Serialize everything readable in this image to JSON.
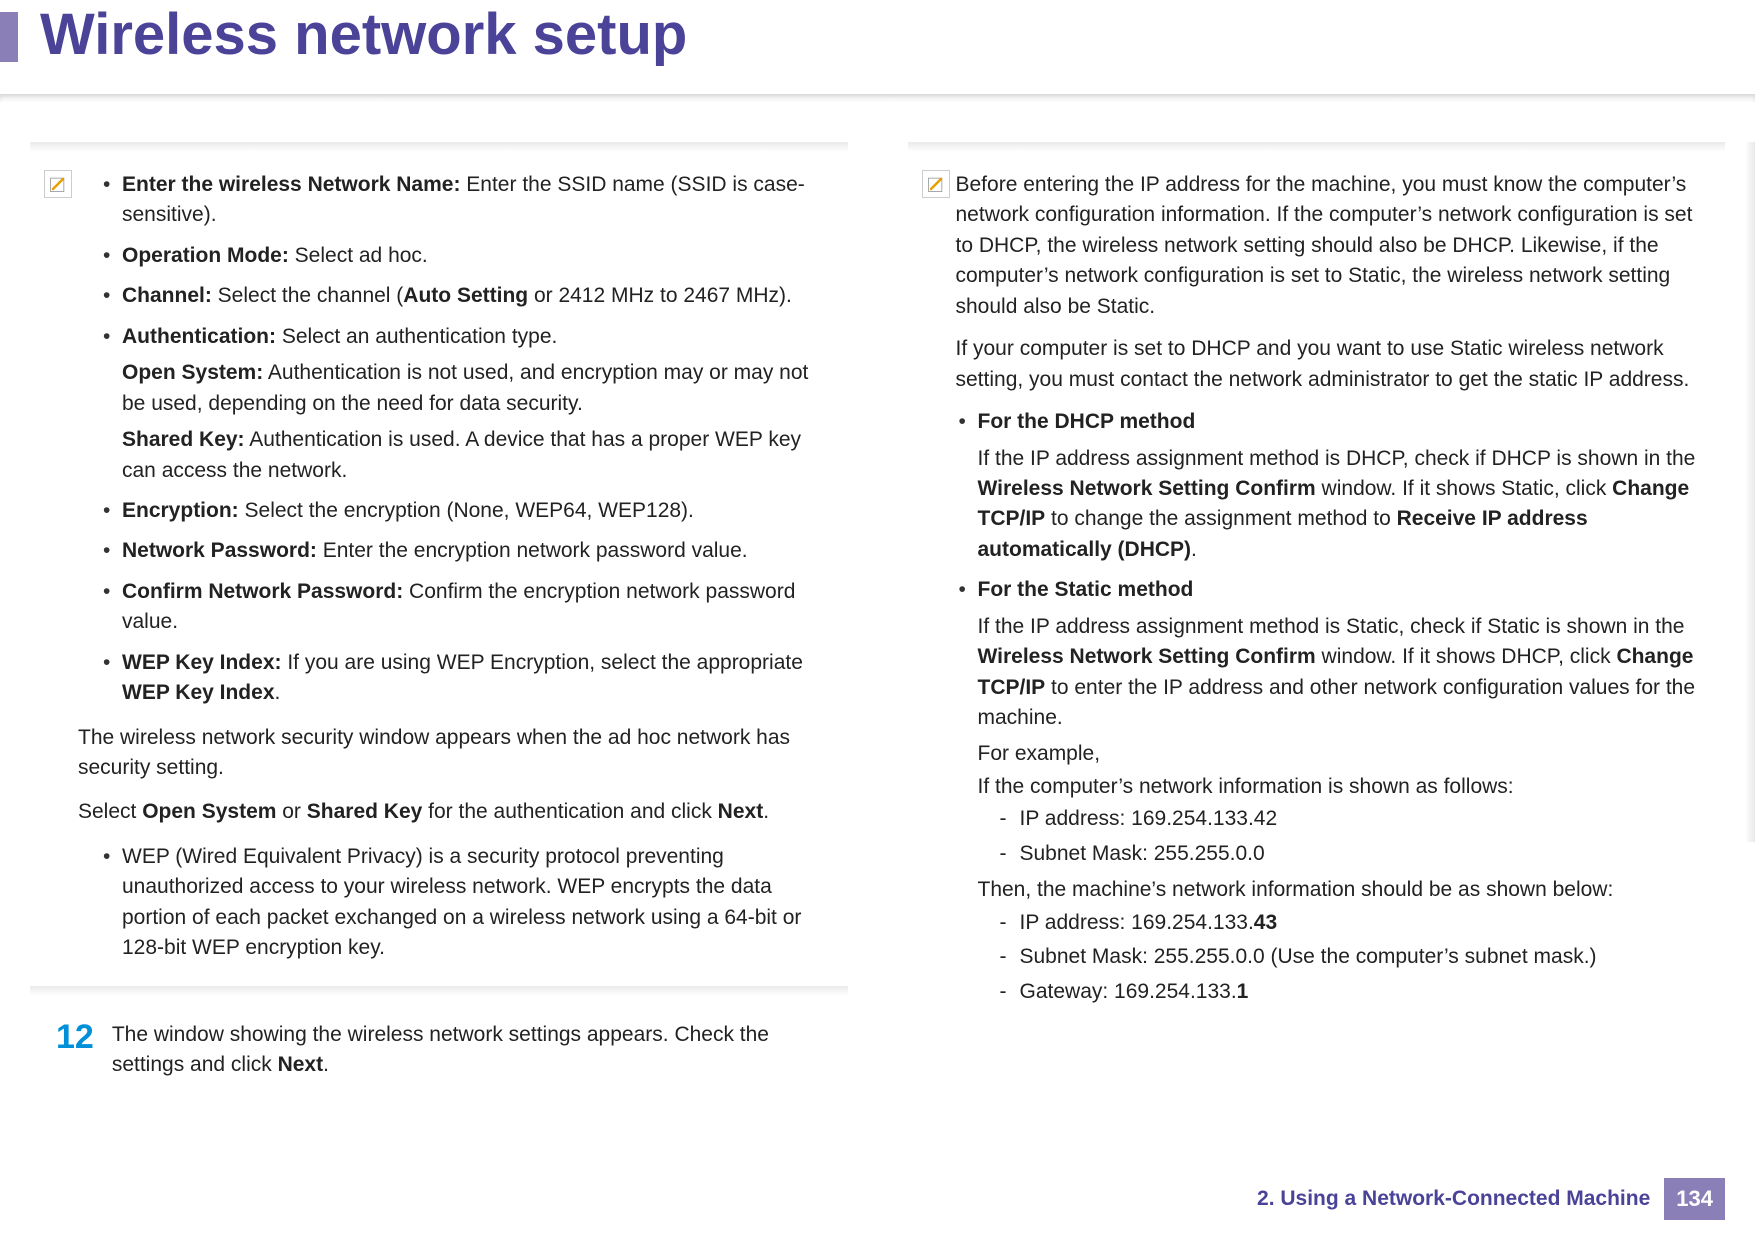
{
  "header": {
    "title": "Wireless network setup"
  },
  "left": {
    "items": [
      {
        "label": "Enter the wireless Network Name:",
        "text": " Enter the SSID name (SSID is case-sensitive)."
      },
      {
        "label": "Operation Mode:",
        "text": " Select ad hoc."
      },
      {
        "label": "Channel:",
        "pre": " Select the channel (",
        "bold2": "Auto Setting",
        "post": " or 2412 MHz to 2467 MHz)."
      },
      {
        "label": "Authentication:",
        "text": " Select an authentication type."
      },
      {
        "label": "Encryption:",
        "text": " Select the encryption (None, WEP64, WEP128)."
      },
      {
        "label": "Network Password:",
        "text": " Enter the encryption network password value."
      },
      {
        "label": "Confirm Network Password:",
        "text": " Confirm the encryption network password value."
      },
      {
        "wep_label": "WEP Key Index:",
        "wep_pre": " If you are using WEP Encryption, select the appropriate ",
        "wep_bold": "WEP Key Index",
        "wep_post": "."
      }
    ],
    "auth_sub": {
      "open_label": "Open System:",
      "open_text": " Authentication is not used, and encryption may or may not be used, depending on the need for data security.",
      "shared_label": "Shared Key:",
      "shared_text": " Authentication is used. A device that has a proper WEP key can access the network."
    },
    "p1": "The wireless network security window appears when the ad hoc network has security setting.",
    "p2_pre": "Select ",
    "p2_b1": "Open System",
    "p2_mid": " or ",
    "p2_b2": "Shared Key",
    "p2_mid2": " for the authentication and click ",
    "p2_b3": "Next",
    "p2_post": ".",
    "wep_desc": "WEP (Wired Equivalent Privacy) is a security protocol preventing unauthorized access to your wireless network. WEP encrypts the data portion of each packet exchanged on a wireless network using a 64-bit or 128-bit WEP encryption key.",
    "step_num": "12",
    "step_pre": "The window showing the wireless network settings appears. Check the settings and click ",
    "step_bold": "Next",
    "step_post": "."
  },
  "right": {
    "intro1": "Before entering the IP address for the machine, you must know the computer’s network configuration information. If the computer’s network configuration is set to DHCP, the wireless network setting should also be DHCP. Likewise, if the computer’s network configuration is set to Static, the wireless network setting should also be Static.",
    "intro2": "If your computer is set to DHCP and you want to use Static wireless network setting, you must contact the network administrator to get the static IP address.",
    "dhcp_h": "For the DHCP method",
    "dhcp_pre": "If the IP address assignment method is DHCP, check if DHCP is shown in the ",
    "dhcp_b1": "Wireless Network Setting Confirm",
    "dhcp_mid": " window. If it shows Static, click ",
    "dhcp_b2": "Change TCP/IP",
    "dhcp_mid2": " to change the assignment method to ",
    "dhcp_b3": "Receive IP address automatically (DHCP)",
    "dhcp_post": ".",
    "static_h": "For the Static method",
    "static_pre": "If the IP address assignment method is Static, check if Static is shown in the ",
    "static_b1": "Wireless Network Setting Confirm",
    "static_mid": " window. If it shows DHCP, click ",
    "static_b2": "Change TCP/IP",
    "static_post": " to enter the IP address and other network configuration values for the machine.",
    "example": "For example,",
    "comp_lead": "If the computer’s network information is shown as follows:",
    "comp": {
      "ip": "IP address: 169.254.133.42",
      "mask": "Subnet Mask: 255.255.0.0"
    },
    "mach_lead": "Then, the machine’s network information should be as shown below:",
    "mach": {
      "ip_pre": "IP address: 169.254.133.",
      "ip_bold": "43",
      "mask": "Subnet Mask: 255.255.0.0 (Use the computer’s subnet mask.)",
      "gw_pre": "Gateway: 169.254.133.",
      "gw_bold": "1"
    }
  },
  "footer": {
    "chapter": "2.  Using a Network-Connected Machine",
    "page": "134"
  }
}
